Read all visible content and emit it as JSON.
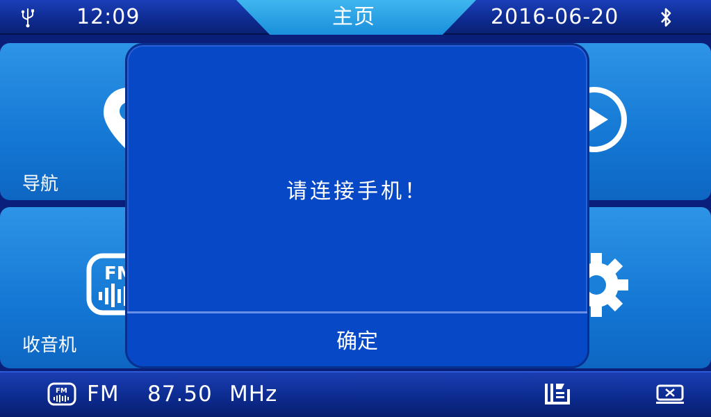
{
  "status_bar": {
    "time": "12:09",
    "title": "主页",
    "date": "2016-06-20",
    "usb_icon": "usb-icon",
    "bluetooth_icon": "bluetooth-icon"
  },
  "tiles": [
    {
      "label": "导航",
      "icon": "map-pin-icon"
    },
    {
      "label": "",
      "icon": "play-icon"
    },
    {
      "label": "收音机",
      "icon": "fm-radio-icon"
    },
    {
      "label": "",
      "icon": "gear-icon"
    }
  ],
  "dialog": {
    "message": "请连接手机！",
    "ok_label": "确定"
  },
  "bottom_bar": {
    "band": "FM",
    "frequency": "87.50",
    "unit": "MHz",
    "fm_icon": "fm-icon",
    "list_icon": "playlist-icon",
    "close_icon": "close-box-icon"
  },
  "colors": {
    "tile_blue": "#1478d4",
    "dialog_blue": "#0748c6",
    "bar_blue": "#0c2a8c"
  }
}
